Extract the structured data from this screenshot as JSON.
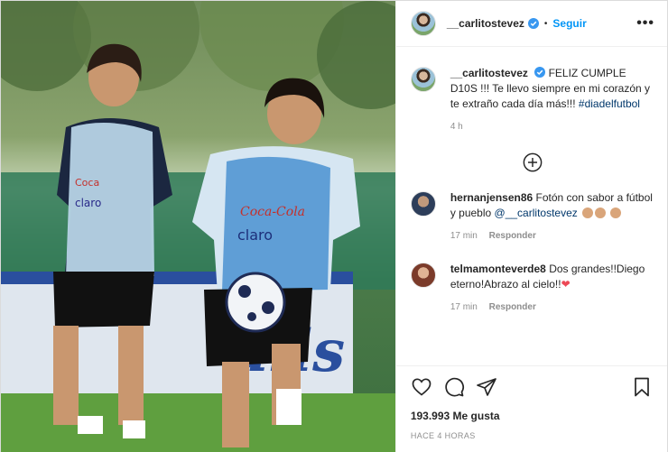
{
  "post": {
    "username": "__carlitostevez",
    "follow_label": "Seguir",
    "more_label": "•••",
    "caption_text": "FELIZ CUMPLE D10S !!! Te llevo siempre en mi corazón y te extraño cada día más!!!",
    "caption_hashtag": "#diadelfutbol",
    "caption_time": "4 h"
  },
  "photo": {
    "bib1_text_1": "Coca",
    "bib1_text_2": "claro",
    "bib2_text_1": "Coca-Cola",
    "bib2_text_2": "claro",
    "banner_text": "uils"
  },
  "comments": [
    {
      "username": "hernanjensen86",
      "text": "Fotón con sabor a fútbol y pueblo",
      "mention": "@__carlitostevez",
      "time": "17 min",
      "reply_label": "Responder"
    },
    {
      "username": "telmamonteverde8",
      "text": "Dos grandes!!Diego eterno!Abrazo al cielo!!",
      "time": "17 min",
      "reply_label": "Responder"
    }
  ],
  "footer": {
    "likes": "193.993 Me gusta",
    "timestamp": "HACE 4 HORAS"
  },
  "icons": {
    "verified": "verified-badge-icon",
    "load_more": "plus-circle-icon",
    "like": "heart-icon",
    "comment": "comment-icon",
    "share": "paper-plane-icon",
    "save": "bookmark-icon"
  },
  "colors": {
    "link_blue": "#0095f6",
    "verified_blue": "#3897f0",
    "muted": "#8e8e8e",
    "heart": "#ed4956"
  }
}
